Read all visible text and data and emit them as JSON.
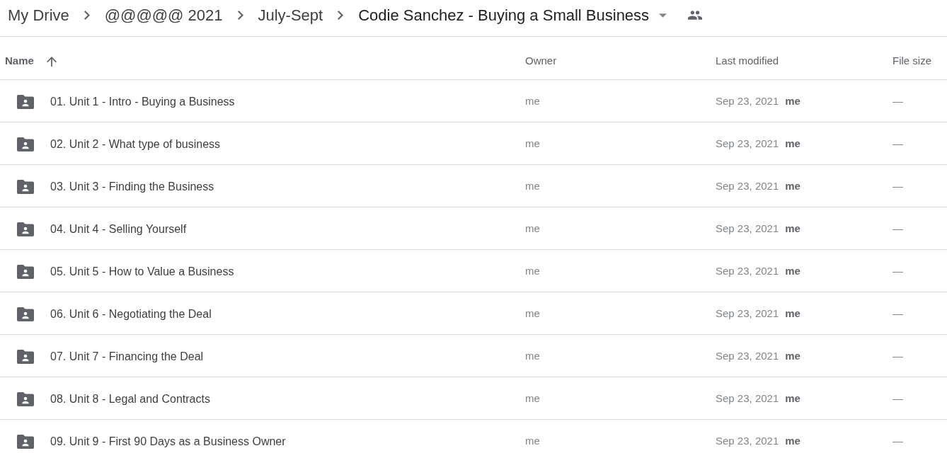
{
  "breadcrumb": [
    {
      "label": "My Drive"
    },
    {
      "label": "@@@@@ 2021"
    },
    {
      "label": "July-Sept"
    },
    {
      "label": "Codie Sanchez - Buying a Small Business",
      "dropdown": true
    }
  ],
  "table": {
    "columns": [
      {
        "label": "Name",
        "sorted": true,
        "ascending": true
      },
      {
        "label": "Owner",
        "sorted": false
      },
      {
        "label": "Last modified",
        "sorted": false
      },
      {
        "label": "File size",
        "sorted": false
      }
    ],
    "rows": [
      {
        "kind": "shared_folder",
        "name": "01. Unit 1 - Intro - Buying a Business",
        "owner": "me",
        "last_modified": "Sep 23, 2021",
        "modified_by": "me",
        "file_size": "—"
      },
      {
        "kind": "shared_folder",
        "name": "02. Unit 2 - What type of business",
        "owner": "me",
        "last_modified": "Sep 23, 2021",
        "modified_by": "me",
        "file_size": "—"
      },
      {
        "kind": "shared_folder",
        "name": "03. Unit 3 - Finding the Business",
        "owner": "me",
        "last_modified": "Sep 23, 2021",
        "modified_by": "me",
        "file_size": "—"
      },
      {
        "kind": "shared_folder",
        "name": "04. Unit 4 - Selling Yourself",
        "owner": "me",
        "last_modified": "Sep 23, 2021",
        "modified_by": "me",
        "file_size": "—"
      },
      {
        "kind": "shared_folder",
        "name": "05. Unit 5 - How to Value a Business",
        "owner": "me",
        "last_modified": "Sep 23, 2021",
        "modified_by": "me",
        "file_size": "—"
      },
      {
        "kind": "shared_folder",
        "name": "06. Unit 6 - Negotiating the Deal",
        "owner": "me",
        "last_modified": "Sep 23, 2021",
        "modified_by": "me",
        "file_size": "—"
      },
      {
        "kind": "shared_folder",
        "name": "07. Unit 7 - Financing the Deal",
        "owner": "me",
        "last_modified": "Sep 23, 2021",
        "modified_by": "me",
        "file_size": "—"
      },
      {
        "kind": "shared_folder",
        "name": "08. Unit 8 - Legal and Contracts",
        "owner": "me",
        "last_modified": "Sep 23, 2021",
        "modified_by": "me",
        "file_size": "—"
      },
      {
        "kind": "shared_folder",
        "name": "09. Unit 9 - First 90 Days as a Business Owner",
        "owner": "me",
        "last_modified": "Sep 23, 2021",
        "modified_by": "me",
        "file_size": "—"
      }
    ]
  }
}
